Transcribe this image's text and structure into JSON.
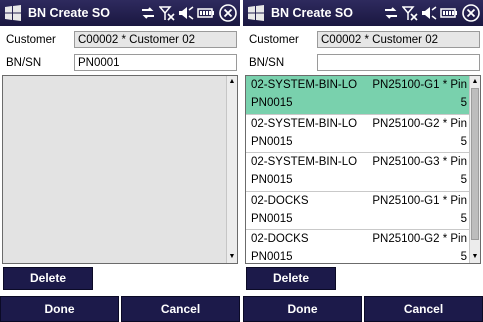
{
  "screens": [
    {
      "title": "BN Create SO",
      "customer_label": "Customer",
      "customer_value": "C00002 * Customer 02",
      "bnsn_label": "BN/SN",
      "bnsn_value": "PN0001",
      "list_rows": [],
      "buttons": {
        "delete": "Delete",
        "done": "Done",
        "cancel": "Cancel"
      }
    },
    {
      "title": "BN Create SO",
      "customer_label": "Customer",
      "customer_value": "C00002 * Customer 02",
      "bnsn_label": "BN/SN",
      "bnsn_value": "",
      "list_rows": [
        {
          "bin": "02-SYSTEM-BIN-LO",
          "item": "PN25100-G1 * Pin",
          "sn": "PN0015",
          "qty": "5",
          "selected": true
        },
        {
          "bin": "02-SYSTEM-BIN-LO",
          "item": "PN25100-G2 * Pin",
          "sn": "PN0015",
          "qty": "5",
          "selected": false
        },
        {
          "bin": "02-SYSTEM-BIN-LO",
          "item": "PN25100-G3 * Pin",
          "sn": "PN0015",
          "qty": "5",
          "selected": false
        },
        {
          "bin": "02-DOCKS",
          "item": "PN25100-G1 * Pin",
          "sn": "PN0015",
          "qty": "5",
          "selected": false
        },
        {
          "bin": "02-DOCKS",
          "item": "PN25100-G2 * Pin",
          "sn": "PN0015",
          "qty": "5",
          "selected": false
        }
      ],
      "buttons": {
        "delete": "Delete",
        "done": "Done",
        "cancel": "Cancel"
      }
    }
  ],
  "status_icons": [
    "data-sync-icon",
    "no-signal-icon",
    "speaker-muted-icon",
    "battery-icon",
    "close-icon"
  ],
  "colors": {
    "titlebar": "#1a1740",
    "button": "#1c1a4a",
    "selected_row": "#79d1ad",
    "readonly_field": "#e6e6e6",
    "empty_list": "#e3e3e3"
  }
}
